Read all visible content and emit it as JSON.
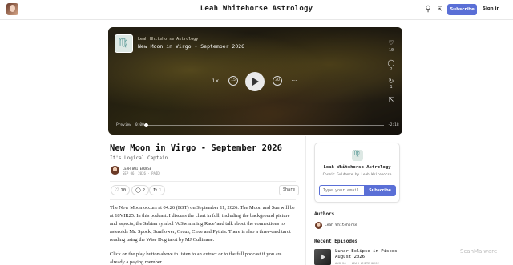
{
  "header": {
    "site_title": "Leah Whitehorse Astrology",
    "subscribe_label": "Subscribe",
    "signin_label": "Sign in",
    "search_icon": "search-icon",
    "share_icon": "share-icon",
    "accent_color": "#5a6fd6"
  },
  "player": {
    "publication": "Leah Whitehorse Astrology",
    "episode_title": "New Moon in Virgo - September 2026",
    "like_count": "10",
    "comment_count": "2",
    "restack_count": "1",
    "speed": "1×",
    "skip_back": "15",
    "skip_forward": "30",
    "more": "···",
    "preview_label": "Preview",
    "time_current": "0:00",
    "time_total": "-2:18",
    "progress": 0
  },
  "article": {
    "title": "New Moon in Virgo - September 2026",
    "subtitle": "It's Logical Captain",
    "author": "LEAH WHITEHORSE",
    "date": "SEP 06, 2026 · PAID",
    "likes": "10",
    "comments": "2",
    "restacks": "1",
    "share_label": "Share",
    "paragraph1": "The New Moon occurs at 04:26 (BST) on September 11, 2026. The Moon and Sun will be at 18VIR25. In this podcast. I discuss the chart in full, including the background picture and aspects, the Sabian symbol 'A Swimming Race' and talk about the connections to asteroids Mr. Spock, Sunflower, Orcus, Circe and Pythia. There is also a three-card tarot reading using the Wise Dog tarot by MJ Cullinane.",
    "paragraph2": "Click on the play button above to listen to an extract or to the full podcast if you are already a paying member."
  },
  "sidebar": {
    "card_name": "Leah Whitehorse Astrology",
    "card_desc": "Cosmic Guidance by Leah Whitehorse",
    "email_placeholder": "Type your email...",
    "subscribe_label": "Subscribe",
    "authors_heading": "Authors",
    "author_name": "Leah Whitehorse",
    "recent_heading": "Recent Episodes",
    "episode_title": "Lunar Eclipse in Pisces - August 2026",
    "episode_meta": "AUG 26 · LEAH WHITEHORSE"
  },
  "watermark": "ScanMalware"
}
